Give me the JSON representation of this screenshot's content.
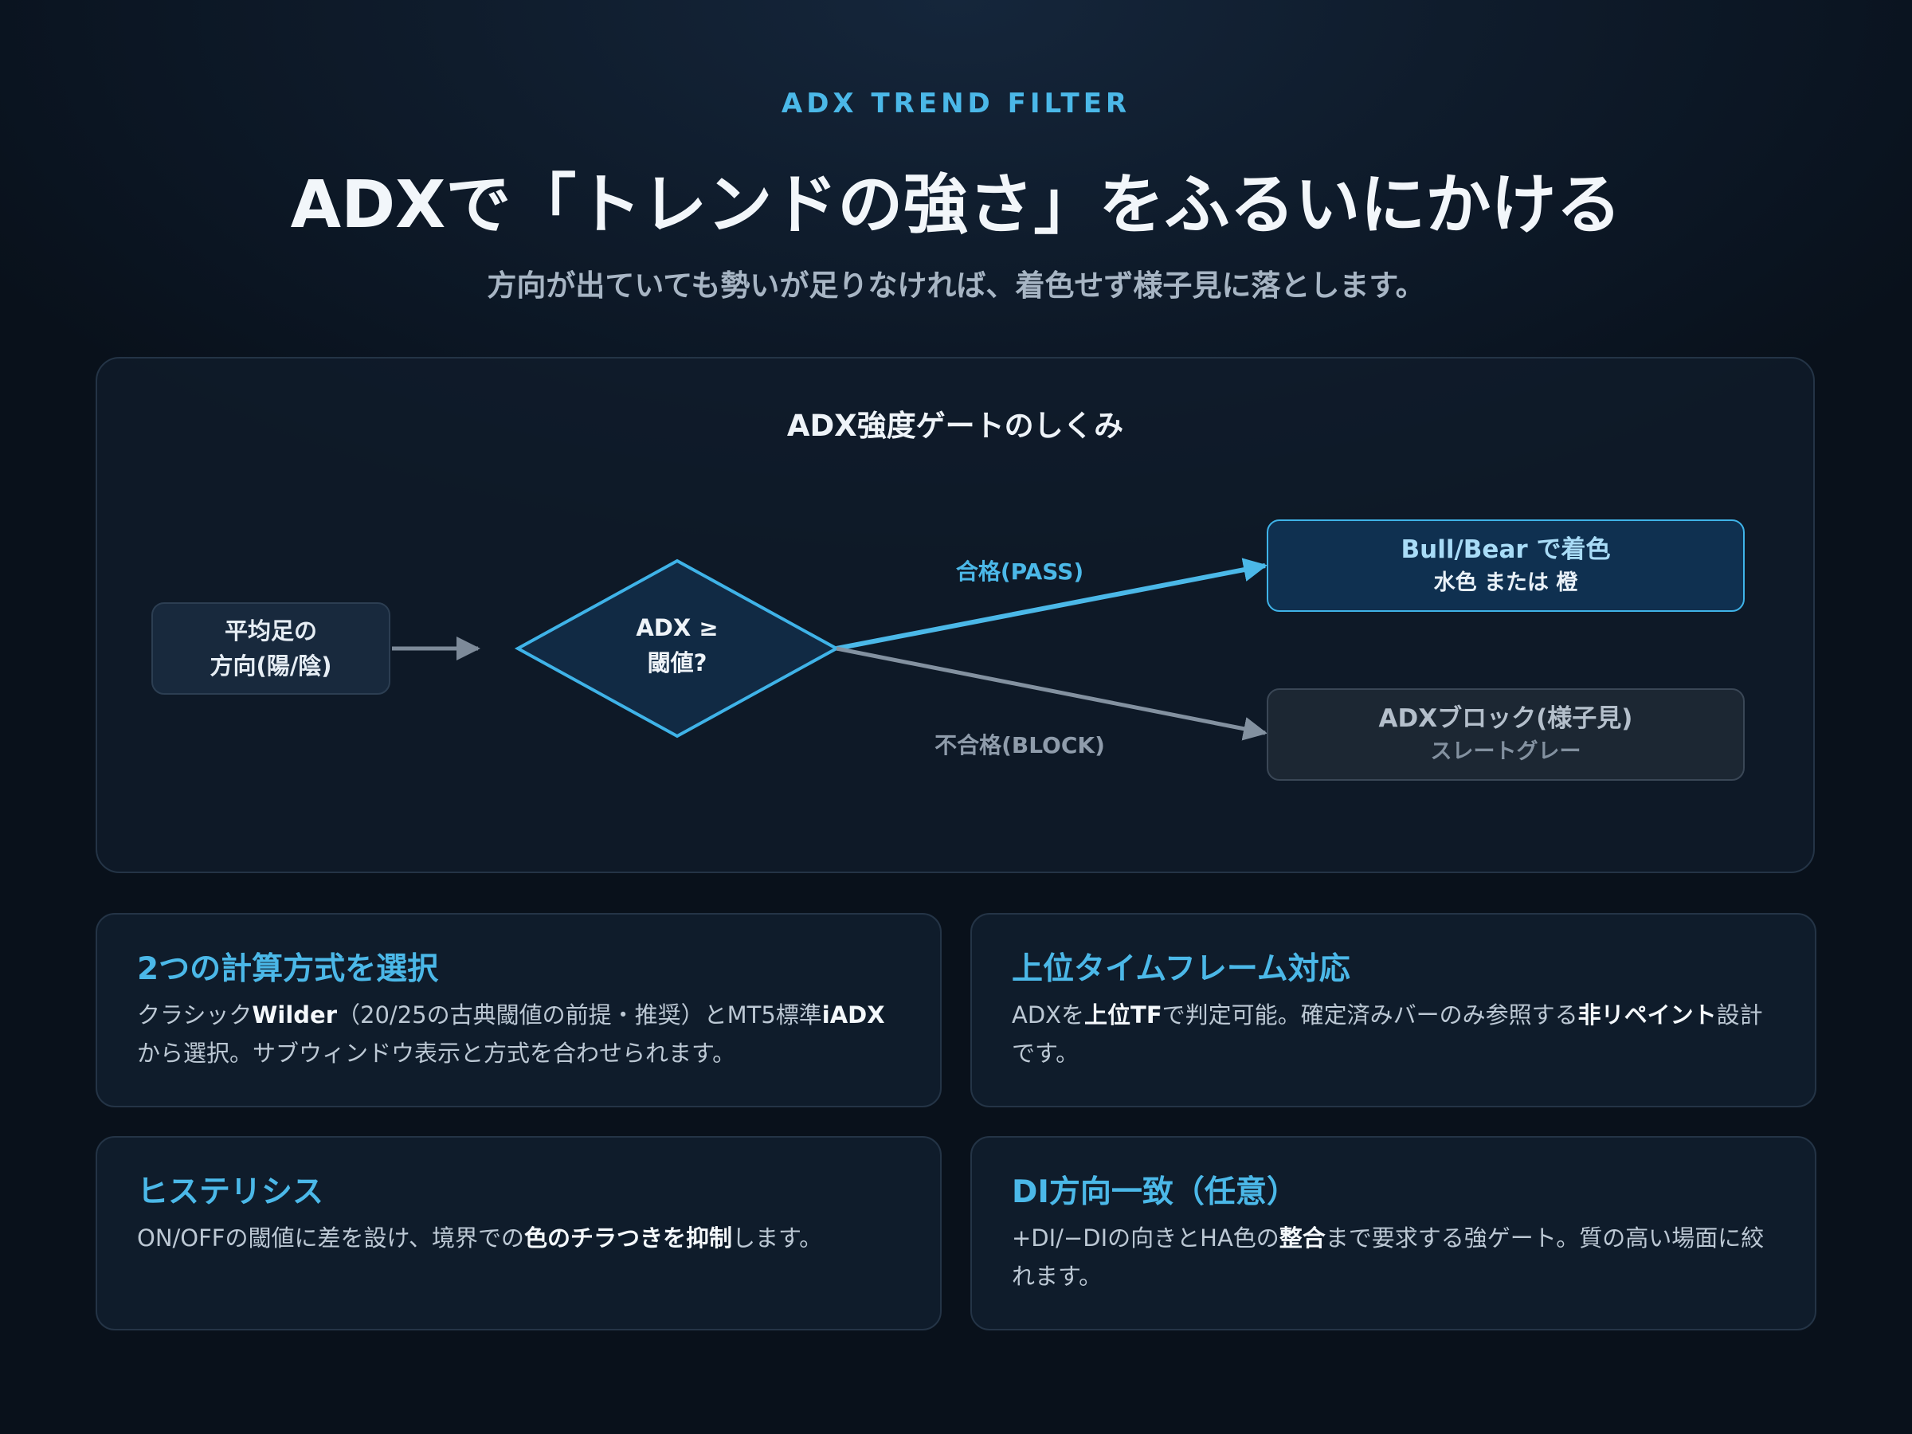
{
  "header": {
    "eyebrow": "ADX TREND FILTER",
    "title": "ADXで「トレンドの強さ」をふるいにかける",
    "subtitle": "方向が出ていても勢いが足りなければ、着色せず様子見に落とします。"
  },
  "diagram": {
    "title": "ADX強度ゲートのしくみ",
    "input_line1": "平均足の",
    "input_line2": "方向(陽/陰)",
    "decision_line1": "ADX ≥",
    "decision_line2": "閾値?",
    "pass_label": "合格(PASS)",
    "block_label": "不合格(BLOCK)",
    "pass_title": "Bull/Bear で着色",
    "pass_sub": "水色 または 橙",
    "block_title": "ADXブロック(様子見)",
    "block_sub": "スレートグレー",
    "colors": {
      "accent": "#4bb8e8",
      "pass_fill": "#0f3050",
      "block_fill": "#1c2733",
      "block_line": "#8391a0",
      "arrow": "#7d8a99"
    }
  },
  "features": [
    {
      "title": "2つの計算方式を選択",
      "b1": "クラシック",
      "b2": "Wilder",
      "b3": "（20/25の古典閾値の前提・推奨）とMT5標準",
      "b4": "iADX",
      "b5": "から選択。サブウィンドウ表示と方式を合わせられます。"
    },
    {
      "title": "上位タイムフレーム対応",
      "b1": "ADXを",
      "b2": "上位TF",
      "b3": "で判定可能。確定済みバーのみ参照する",
      "b4": "非リペイント",
      "b5": "設計です。"
    },
    {
      "title": "ヒステリシス",
      "b1": "ON/OFFの閾値に差を設け、境界での",
      "b2": "色のチラつきを抑制",
      "b3": "します。"
    },
    {
      "title": "DI方向一致（任意）",
      "b1": "+DI/−DIの向きとHA色の",
      "b2": "整合",
      "b3": "まで要求する強ゲート。質の高い場面に絞れます。"
    }
  ]
}
